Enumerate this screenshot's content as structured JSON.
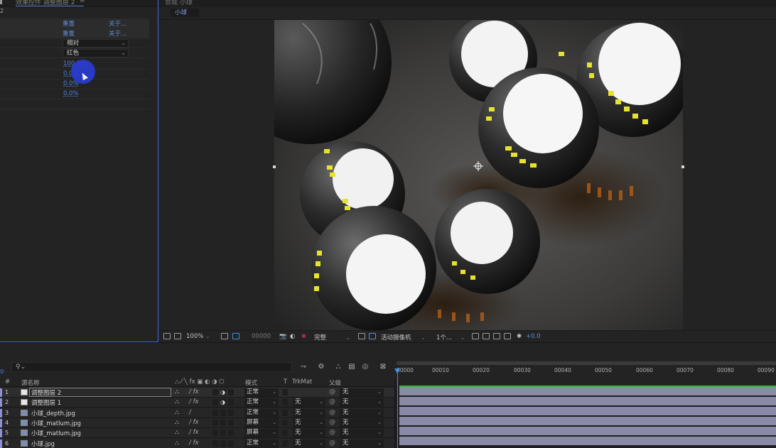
{
  "effect_controls": {
    "tab_title": "效果控件 调整图层 2",
    "layer_label": "2",
    "rows": [
      {
        "left": "重置",
        "right": "关于..."
      },
      {
        "left": "重置",
        "right": "关于..."
      },
      {
        "dropdown": "相对"
      },
      {
        "dropdown": "红色"
      },
      {
        "value": "100.0%"
      },
      {
        "value": "0.0%"
      },
      {
        "value": "0.0%"
      },
      {
        "value": "0.0%"
      }
    ]
  },
  "composition": {
    "tab_title": "合成 小球",
    "breadcrumb": "小球",
    "toolbar": {
      "zoom": "100%",
      "timecode": "00000",
      "resolution": "完整",
      "camera": "活动摄像机",
      "views": "1个...",
      "exposure": "+0.0"
    }
  },
  "timeline": {
    "timecode": "00000",
    "search_placeholder": "",
    "search_icon": "search-icon",
    "headers": {
      "num": "#",
      "source": "源名称",
      "mode": "模式",
      "t": "T",
      "trkmat": "TrkMat",
      "parent": "父级"
    },
    "ruler_ticks": [
      "00000",
      "00010",
      "00020",
      "00030",
      "00040",
      "00050",
      "00060",
      "00070",
      "00080",
      "00090"
    ],
    "layers": [
      {
        "num": "1",
        "name": "调整图层 2",
        "mode": "正常",
        "trkmat": "",
        "parent": "无",
        "fx": "/ fx",
        "type": "solid"
      },
      {
        "num": "2",
        "name": "调整图层 1",
        "mode": "正常",
        "trkmat": "无",
        "parent": "无",
        "fx": "/ fx",
        "type": "solid"
      },
      {
        "num": "3",
        "name": "小球_depth.jpg",
        "mode": "正常",
        "trkmat": "无",
        "parent": "无",
        "fx": "/",
        "type": "image"
      },
      {
        "num": "4",
        "name": "小球_matlum.jpg",
        "mode": "屏幕",
        "trkmat": "无",
        "parent": "无",
        "fx": "/ fx",
        "type": "image"
      },
      {
        "num": "5",
        "name": "小球_matlum.jpg",
        "mode": "屏幕",
        "trkmat": "无",
        "parent": "无",
        "fx": "/ fx",
        "type": "image"
      },
      {
        "num": "6",
        "name": "小球.jpg",
        "mode": "正常",
        "trkmat": "无",
        "parent": "无",
        "fx": "/ fx",
        "type": "image"
      }
    ]
  },
  "colors": {
    "accent_blue": "#3d6bd9",
    "value_blue": "#4f7fd8",
    "layer_label": "#8f8fd6",
    "track_bar": "#8a8aa8",
    "work_area_green": "#3fae3f"
  }
}
